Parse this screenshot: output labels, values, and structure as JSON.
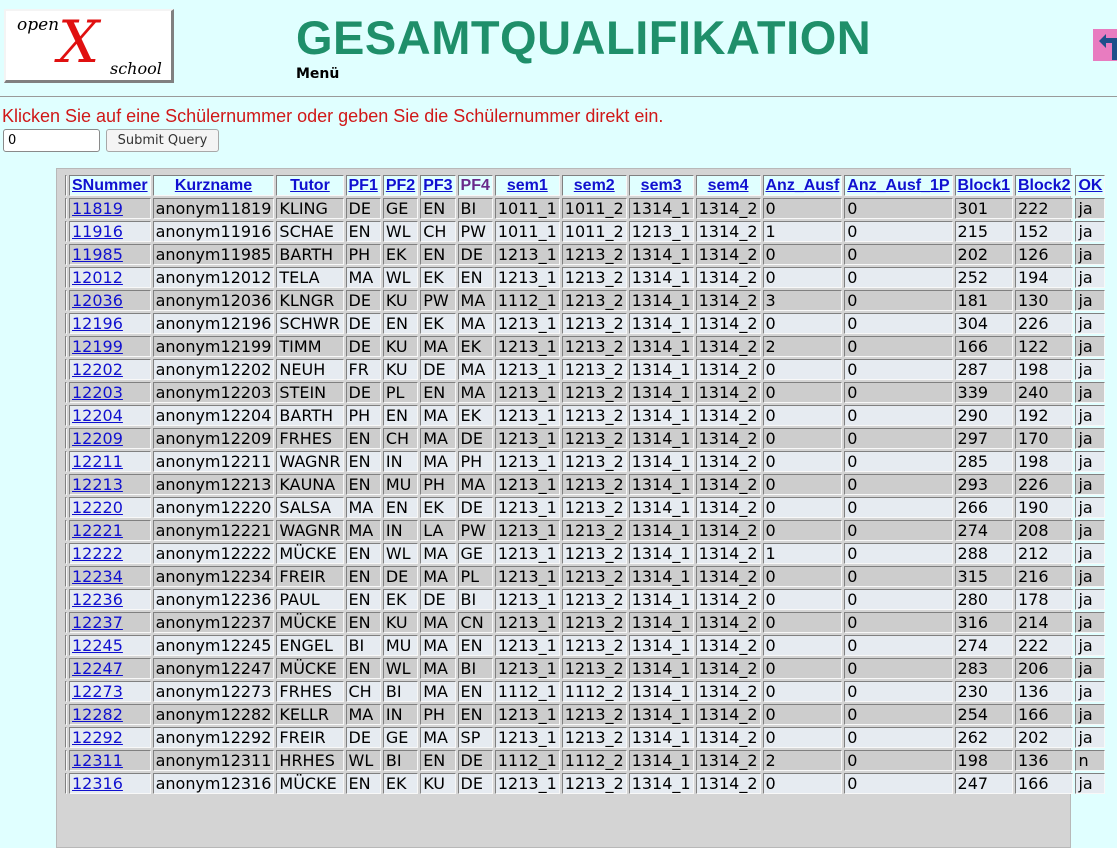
{
  "logo": {
    "word1": "open",
    "word2": "X",
    "word3": "school"
  },
  "header": {
    "title": "GESAMTQUALIFIKATION",
    "menu_label": "Menü"
  },
  "instruction": "Klicken Sie auf eine Schülernummer oder geben Sie die Schülernummer direkt ein.",
  "form": {
    "input_value": "0",
    "submit_label": "Submit Query"
  },
  "icons": {
    "back": "back-arrow-icon"
  },
  "colors": {
    "background": "#e0ffff",
    "title": "#1f8f6a",
    "instruction": "#d01818",
    "link": "#1010d0",
    "back_button": "#e87cc0"
  },
  "table": {
    "columns": [
      "SNummer",
      "Kurzname",
      "Tutor",
      "PF1",
      "PF2",
      "PF3",
      "PF4",
      "sem1",
      "sem2",
      "sem3",
      "sem4",
      "Anz_Ausf",
      "Anz_Ausf_1P",
      "Block1",
      "Block2",
      "OK"
    ],
    "rows": [
      [
        "11819",
        "anonym11819",
        "KLING",
        "DE",
        "GE",
        "EN",
        "BI",
        "1011_1",
        "1011_2",
        "1314_1",
        "1314_2",
        "0",
        "0",
        "301",
        "222",
        "ja"
      ],
      [
        "11916",
        "anonym11916",
        "SCHAE",
        "EN",
        "WL",
        "CH",
        "PW",
        "1011_1",
        "1011_2",
        "1213_1",
        "1314_2",
        "1",
        "0",
        "215",
        "152",
        "ja"
      ],
      [
        "11985",
        "anonym11985",
        "BARTH",
        "PH",
        "EK",
        "EN",
        "DE",
        "1213_1",
        "1213_2",
        "1314_1",
        "1314_2",
        "0",
        "0",
        "202",
        "126",
        "ja"
      ],
      [
        "12012",
        "anonym12012",
        "TELA",
        "MA",
        "WL",
        "EK",
        "EN",
        "1213_1",
        "1213_2",
        "1314_1",
        "1314_2",
        "0",
        "0",
        "252",
        "194",
        "ja"
      ],
      [
        "12036",
        "anonym12036",
        "KLNGR",
        "DE",
        "KU",
        "PW",
        "MA",
        "1112_1",
        "1213_2",
        "1314_1",
        "1314_2",
        "3",
        "0",
        "181",
        "130",
        "ja"
      ],
      [
        "12196",
        "anonym12196",
        "SCHWR",
        "DE",
        "EN",
        "EK",
        "MA",
        "1213_1",
        "1213_2",
        "1314_1",
        "1314_2",
        "0",
        "0",
        "304",
        "226",
        "ja"
      ],
      [
        "12199",
        "anonym12199",
        "TIMM",
        "DE",
        "KU",
        "MA",
        "EK",
        "1213_1",
        "1213_2",
        "1314_1",
        "1314_2",
        "2",
        "0",
        "166",
        "122",
        "ja"
      ],
      [
        "12202",
        "anonym12202",
        "NEUH",
        "FR",
        "KU",
        "DE",
        "MA",
        "1213_1",
        "1213_2",
        "1314_1",
        "1314_2",
        "0",
        "0",
        "287",
        "198",
        "ja"
      ],
      [
        "12203",
        "anonym12203",
        "STEIN",
        "DE",
        "PL",
        "EN",
        "MA",
        "1213_1",
        "1213_2",
        "1314_1",
        "1314_2",
        "0",
        "0",
        "339",
        "240",
        "ja"
      ],
      [
        "12204",
        "anonym12204",
        "BARTH",
        "PH",
        "EN",
        "MA",
        "EK",
        "1213_1",
        "1213_2",
        "1314_1",
        "1314_2",
        "0",
        "0",
        "290",
        "192",
        "ja"
      ],
      [
        "12209",
        "anonym12209",
        "FRHES",
        "EN",
        "CH",
        "MA",
        "DE",
        "1213_1",
        "1213_2",
        "1314_1",
        "1314_2",
        "0",
        "0",
        "297",
        "170",
        "ja"
      ],
      [
        "12211",
        "anonym12211",
        "WAGNR",
        "EN",
        "IN",
        "MA",
        "PH",
        "1213_1",
        "1213_2",
        "1314_1",
        "1314_2",
        "0",
        "0",
        "285",
        "198",
        "ja"
      ],
      [
        "12213",
        "anonym12213",
        "KAUNA",
        "EN",
        "MU",
        "PH",
        "MA",
        "1213_1",
        "1213_2",
        "1314_1",
        "1314_2",
        "0",
        "0",
        "293",
        "226",
        "ja"
      ],
      [
        "12220",
        "anonym12220",
        "SALSA",
        "MA",
        "EN",
        "EK",
        "DE",
        "1213_1",
        "1213_2",
        "1314_1",
        "1314_2",
        "0",
        "0",
        "266",
        "190",
        "ja"
      ],
      [
        "12221",
        "anonym12221",
        "WAGNR",
        "MA",
        "IN",
        "LA",
        "PW",
        "1213_1",
        "1213_2",
        "1314_1",
        "1314_2",
        "0",
        "0",
        "274",
        "208",
        "ja"
      ],
      [
        "12222",
        "anonym12222",
        "MÜCKE",
        "EN",
        "WL",
        "MA",
        "GE",
        "1213_1",
        "1213_2",
        "1314_1",
        "1314_2",
        "1",
        "0",
        "288",
        "212",
        "ja"
      ],
      [
        "12234",
        "anonym12234",
        "FREIR",
        "EN",
        "DE",
        "MA",
        "PL",
        "1213_1",
        "1213_2",
        "1314_1",
        "1314_2",
        "0",
        "0",
        "315",
        "216",
        "ja"
      ],
      [
        "12236",
        "anonym12236",
        "PAUL",
        "EN",
        "EK",
        "DE",
        "BI",
        "1213_1",
        "1213_2",
        "1314_1",
        "1314_2",
        "0",
        "0",
        "280",
        "178",
        "ja"
      ],
      [
        "12237",
        "anonym12237",
        "MÜCKE",
        "EN",
        "KU",
        "MA",
        "CN",
        "1213_1",
        "1213_2",
        "1314_1",
        "1314_2",
        "0",
        "0",
        "316",
        "214",
        "ja"
      ],
      [
        "12245",
        "anonym12245",
        "ENGEL",
        "BI",
        "MU",
        "MA",
        "EN",
        "1213_1",
        "1213_2",
        "1314_1",
        "1314_2",
        "0",
        "0",
        "274",
        "222",
        "ja"
      ],
      [
        "12247",
        "anonym12247",
        "MÜCKE",
        "EN",
        "WL",
        "MA",
        "BI",
        "1213_1",
        "1213_2",
        "1314_1",
        "1314_2",
        "0",
        "0",
        "283",
        "206",
        "ja"
      ],
      [
        "12273",
        "anonym12273",
        "FRHES",
        "CH",
        "BI",
        "MA",
        "EN",
        "1112_1",
        "1112_2",
        "1314_1",
        "1314_2",
        "0",
        "0",
        "230",
        "136",
        "ja"
      ],
      [
        "12282",
        "anonym12282",
        "KELLR",
        "MA",
        "IN",
        "PH",
        "EN",
        "1213_1",
        "1213_2",
        "1314_1",
        "1314_2",
        "0",
        "0",
        "254",
        "166",
        "ja"
      ],
      [
        "12292",
        "anonym12292",
        "FREIR",
        "DE",
        "GE",
        "MA",
        "SP",
        "1213_1",
        "1213_2",
        "1314_1",
        "1314_2",
        "0",
        "0",
        "262",
        "202",
        "ja"
      ],
      [
        "12311",
        "anonym12311",
        "HRHES",
        "WL",
        "BI",
        "EN",
        "DE",
        "1112_1",
        "1112_2",
        "1314_1",
        "1314_2",
        "2",
        "0",
        "198",
        "136",
        "n"
      ],
      [
        "12316",
        "anonym12316",
        "MÜCKE",
        "EN",
        "EK",
        "KU",
        "DE",
        "1213_1",
        "1213_2",
        "1314_1",
        "1314_2",
        "0",
        "0",
        "247",
        "166",
        "ja"
      ]
    ]
  }
}
